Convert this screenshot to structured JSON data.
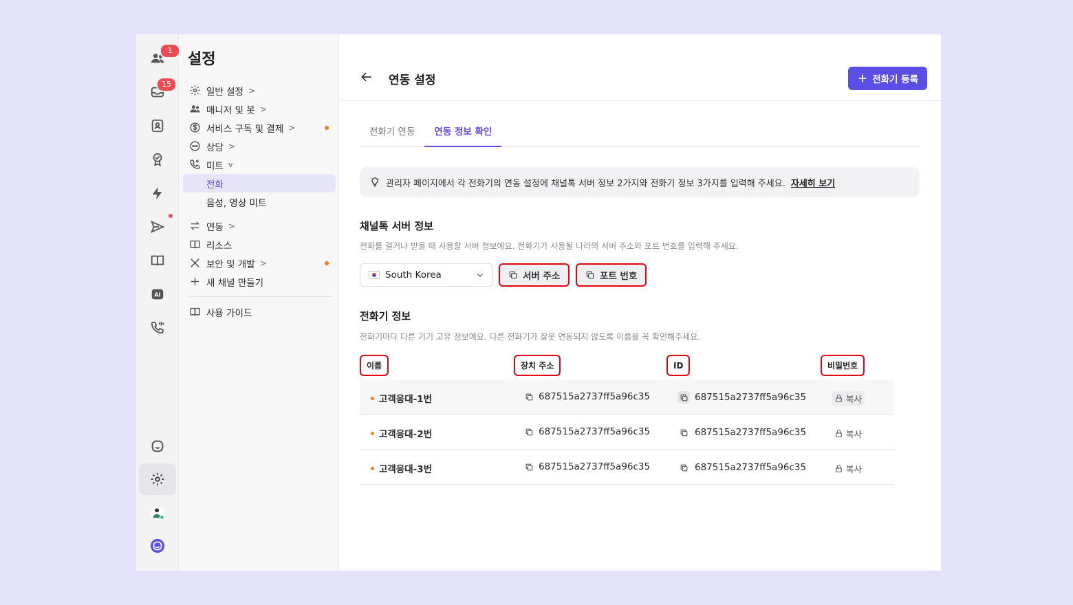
{
  "rail": {
    "badges": {
      "contacts": "1",
      "inbox": "15"
    }
  },
  "sidebar": {
    "title": "설정",
    "items": [
      {
        "label": "일반 설정",
        "icon": "gear-icon"
      },
      {
        "label": "매니저 및 봇",
        "icon": "people-icon"
      },
      {
        "label": "서비스 구독 및 결제",
        "icon": "dollar-icon"
      },
      {
        "label": "상담",
        "icon": "chat-icon"
      },
      {
        "label": "미트",
        "icon": "phone-icon"
      },
      {
        "label": "전화"
      },
      {
        "label": "음성, 영상 미트"
      },
      {
        "label": "연동",
        "icon": "swap-icon"
      },
      {
        "label": "리소스",
        "icon": "book-icon"
      },
      {
        "label": "보안 및 개발",
        "icon": "tools-icon"
      },
      {
        "label": "새 채널 만들기",
        "icon": "plus-icon"
      },
      {
        "label": "사용 가이드",
        "icon": "book-icon"
      }
    ]
  },
  "header": {
    "title": "연동 설정",
    "register_button": "전화기 등록"
  },
  "tabs": [
    {
      "label": "전화기 연동"
    },
    {
      "label": "연동 정보 확인"
    }
  ],
  "info": {
    "text": "관리자 페이지에서 각 전화기의 연동 설정에 채널톡 서버 정보 2가지와 전화기 정보 3가지를 입력해 주세요.",
    "link": "자세히 보기"
  },
  "server": {
    "title": "채널톡 서버 정보",
    "desc": "전화를 걸거나 받을 때 사용할 서버 정보에요. 전화기가 사용될 나라의 서버 주소와 포트 번호를 입력해 주세요.",
    "country": "South Korea",
    "address_button": "서버 주소",
    "port_button": "포트 번호"
  },
  "phones": {
    "title": "전화기 정보",
    "desc": "전화기마다 다른 기기 고유 정보에요. 다른 전화기가 잘못 연동되지 않도록 이름을 꼭 확인해주세요.",
    "columns": {
      "name": "이름",
      "address": "장치 주소",
      "id": "ID",
      "password": "비밀번호"
    },
    "rows": [
      {
        "name": "고객응대-1번",
        "address": "687515a2737ff5a96c35",
        "id": "687515a2737ff5a96c35",
        "password": "복사"
      },
      {
        "name": "고객응대-2번",
        "address": "687515a2737ff5a96c35",
        "id": "687515a2737ff5a96c35",
        "password": "복사"
      },
      {
        "name": "고객응대-3번",
        "address": "687515a2737ff5a96c35",
        "id": "687515a2737ff5a96c35",
        "password": "복사"
      }
    ]
  },
  "colors": {
    "accent": "#5a4ee6",
    "highlight": "#e60012",
    "dot": "#f07e1e"
  }
}
